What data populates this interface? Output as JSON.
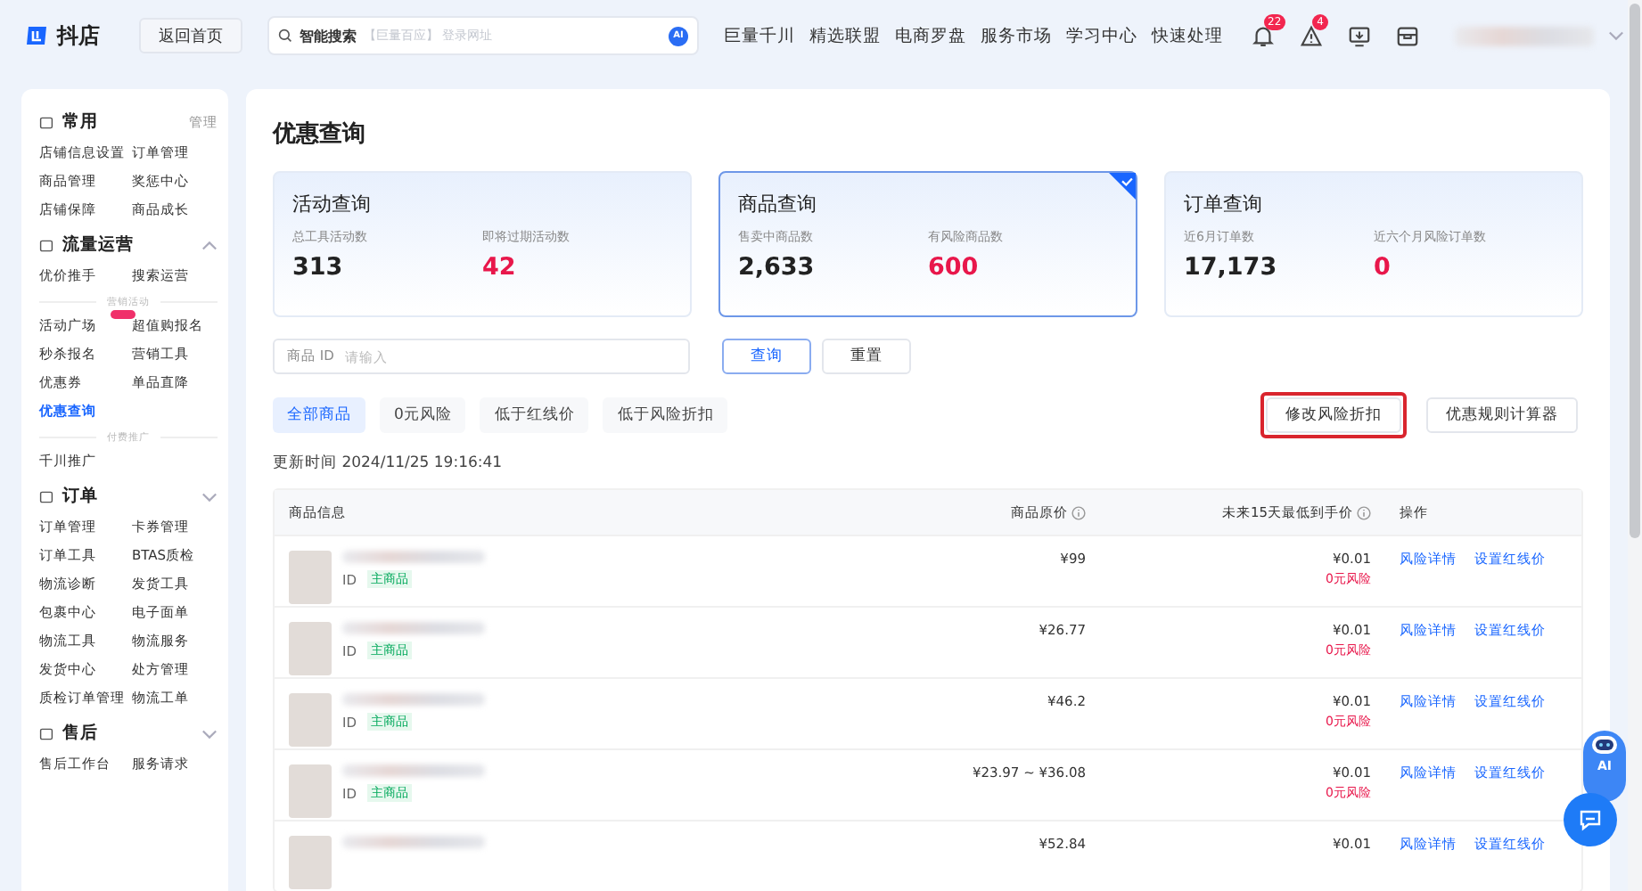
{
  "topbar": {
    "logo": "抖店",
    "home_button": "返回首页",
    "search": {
      "label": "智能搜索",
      "placeholder": "【巨量百应】 登录网址",
      "ai_badge": "AI"
    },
    "links": [
      "巨量千川",
      "精选联盟",
      "电商罗盘",
      "服务市场",
      "学习中心",
      "快速处理"
    ],
    "icons": [
      {
        "kind": "bell",
        "badge": "22"
      },
      {
        "kind": "alert",
        "badge": "4"
      },
      {
        "kind": "monitor"
      },
      {
        "kind": "box"
      }
    ]
  },
  "sidebar": {
    "sections": [
      {
        "title": "常用",
        "action": "管理",
        "groups": [
          {
            "items": [
              {
                "label": "店铺信息设置",
                "selected": false
              },
              {
                "label": "订单管理",
                "selected": false
              },
              {
                "label": "商品管理",
                "selected": false
              },
              {
                "label": "奖惩中心",
                "selected": false
              },
              {
                "label": "店铺保障",
                "selected": false
              },
              {
                "label": "商品成长",
                "selected": false
              }
            ]
          }
        ]
      },
      {
        "title": "流量运营",
        "expanded": true,
        "groups": [
          {
            "items": [
              {
                "label": "优价推手",
                "selected": false
              },
              {
                "label": "搜索运营",
                "selected": false
              }
            ]
          },
          {
            "heading": "营销活动",
            "items": [
              {
                "label": "活动广场",
                "selected": false,
                "badge": true
              },
              {
                "label": "超值购报名",
                "selected": false
              },
              {
                "label": "秒杀报名",
                "selected": false
              },
              {
                "label": "营销工具",
                "selected": false
              },
              {
                "label": "优惠券",
                "selected": false
              },
              {
                "label": "单品直降",
                "selected": false
              },
              {
                "label": "优惠查询",
                "selected": true
              }
            ]
          },
          {
            "heading": "付费推广",
            "items": [
              {
                "label": "千川推广",
                "selected": false
              }
            ]
          }
        ]
      },
      {
        "title": "订单",
        "expanded": false,
        "groups": [
          {
            "items": [
              {
                "label": "订单管理",
                "selected": false
              },
              {
                "label": "卡券管理",
                "selected": false
              },
              {
                "label": "订单工具",
                "selected": false
              },
              {
                "label": "BTAS质检",
                "selected": false
              },
              {
                "label": "物流诊断",
                "selected": false
              },
              {
                "label": "发货工具",
                "selected": false
              },
              {
                "label": "包裹中心",
                "selected": false
              },
              {
                "label": "电子面单",
                "selected": false
              },
              {
                "label": "物流工具",
                "selected": false
              },
              {
                "label": "物流服务",
                "selected": false
              },
              {
                "label": "发货中心",
                "selected": false
              },
              {
                "label": "处方管理",
                "selected": false
              },
              {
                "label": "质检订单管理",
                "selected": false
              },
              {
                "label": "物流工单",
                "selected": false
              }
            ]
          }
        ]
      },
      {
        "title": "售后",
        "expanded": false,
        "groups": [
          {
            "items": [
              {
                "label": "售后工作台",
                "selected": false
              },
              {
                "label": "服务请求",
                "selected": false
              }
            ]
          }
        ]
      }
    ]
  },
  "main": {
    "title": "优惠查询",
    "cards": [
      {
        "title": "活动查询",
        "selected": false,
        "metrics": [
          {
            "label": "总工具活动数",
            "value": "313",
            "alert": false
          },
          {
            "label": "即将过期活动数",
            "value": "42",
            "alert": true
          }
        ]
      },
      {
        "title": "商品查询",
        "selected": true,
        "metrics": [
          {
            "label": "售卖中商品数",
            "value": "2,633",
            "alert": false
          },
          {
            "label": "有风险商品数",
            "value": "600",
            "alert": true
          }
        ]
      },
      {
        "title": "订单查询",
        "selected": false,
        "metrics": [
          {
            "label": "近6月订单数",
            "value": "17,173",
            "alert": false
          },
          {
            "label": "近六个月风险订单数",
            "value": "0",
            "alert": true
          }
        ]
      }
    ],
    "filter": {
      "field_label": "商品 ID",
      "placeholder": "请输入",
      "buttons": [
        {
          "label": "查询",
          "primary": true
        },
        {
          "label": "重置",
          "primary": false
        }
      ]
    },
    "tabs": [
      {
        "label": "全部商品",
        "selected": true
      },
      {
        "label": "0元风险",
        "selected": false
      },
      {
        "label": "低于红线价",
        "selected": false
      },
      {
        "label": "低于风险折扣",
        "selected": false
      }
    ],
    "actions": [
      {
        "label": "修改风险折扣",
        "highlighted": true
      },
      {
        "label": "优惠规则计算器",
        "highlighted": false
      }
    ],
    "updated": "更新时间 2024/11/25 19:16:41",
    "table": {
      "columns": [
        {
          "label": "商品信息",
          "info": false
        },
        {
          "label": "商品原价",
          "info": true
        },
        {
          "label": "未来15天最低到手价",
          "info": true
        },
        {
          "label": "操作",
          "info": false
        }
      ],
      "rows": [
        {
          "id_label": "ID",
          "tag": "主商品",
          "price": "¥99",
          "lowest": "¥0.01",
          "risk": "0元风险",
          "actions": [
            "风险详情",
            "设置红线价"
          ]
        },
        {
          "id_label": "ID",
          "tag": "主商品",
          "price": "¥26.77",
          "lowest": "¥0.01",
          "risk": "0元风险",
          "actions": [
            "风险详情",
            "设置红线价"
          ]
        },
        {
          "id_label": "ID",
          "tag": "主商品",
          "price": "¥46.2",
          "lowest": "¥0.01",
          "risk": "0元风险",
          "actions": [
            "风险详情",
            "设置红线价"
          ]
        },
        {
          "id_label": "ID",
          "tag": "主商品",
          "price": "¥23.97 ~ ¥36.08",
          "lowest": "¥0.01",
          "risk": "0元风险",
          "actions": [
            "风险详情",
            "设置红线价"
          ]
        },
        {
          "price": "¥52.84",
          "lowest": "¥0.01",
          "actions": [
            "风险详情",
            "设置红线价"
          ]
        }
      ]
    }
  },
  "assistant": {
    "label": "AI"
  }
}
